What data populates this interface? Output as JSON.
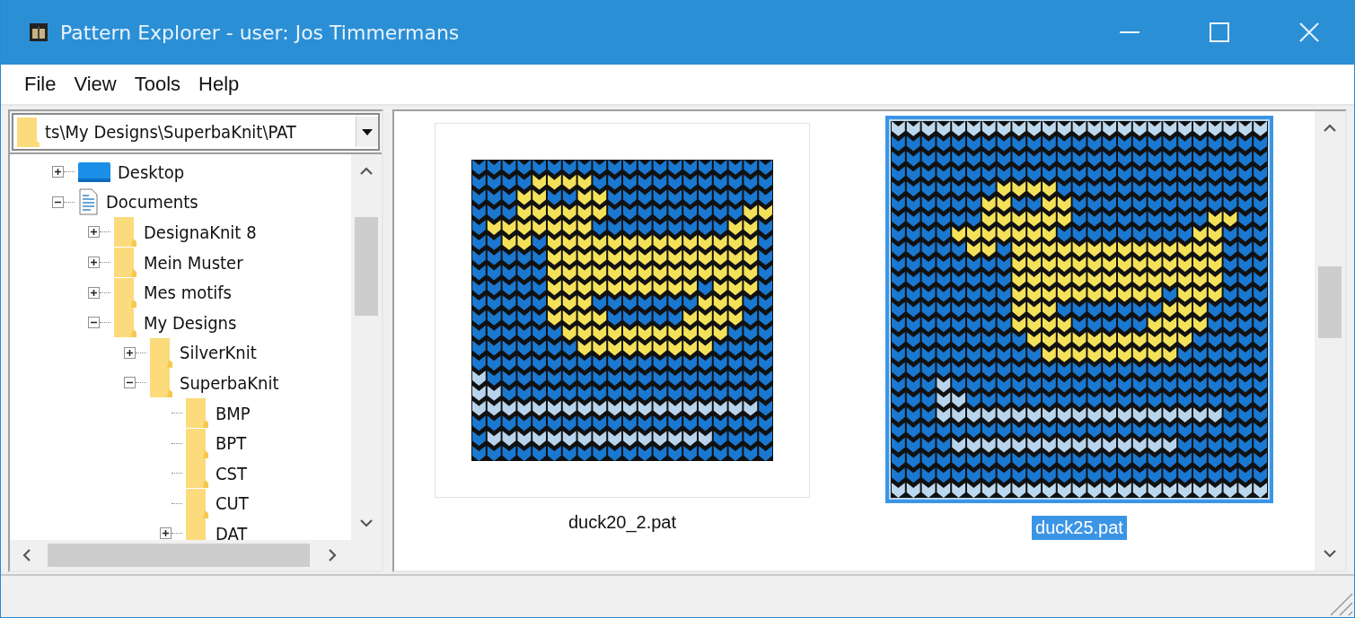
{
  "window": {
    "title": "Pattern Explorer - user: Jos Timmermans"
  },
  "menu": [
    "File",
    "View",
    "Tools",
    "Help"
  ],
  "path_box": {
    "value": "ts\\My Designs\\SuperbaKnit\\PAT"
  },
  "tree": [
    {
      "label": "Desktop",
      "kind": "desktop",
      "expanded": false
    },
    {
      "label": "Documents",
      "kind": "documents",
      "expanded": true,
      "children": [
        {
          "label": "DesignaKnit 8",
          "kind": "folder",
          "expanded": false
        },
        {
          "label": "Mein Muster",
          "kind": "folder",
          "expanded": false
        },
        {
          "label": "Mes motifs",
          "kind": "folder",
          "expanded": false
        },
        {
          "label": "My Designs",
          "kind": "folder",
          "expanded": true,
          "children": [
            {
              "label": "SilverKnit",
              "kind": "folder",
              "expanded": false
            },
            {
              "label": "SuperbaKnit",
              "kind": "folder",
              "expanded": true,
              "children": [
                {
                  "label": "BMP",
                  "kind": "folder"
                },
                {
                  "label": "BPT",
                  "kind": "folder"
                },
                {
                  "label": "CST",
                  "kind": "folder"
                },
                {
                  "label": "CUT",
                  "kind": "folder"
                },
                {
                  "label": "DAT",
                  "kind": "folder",
                  "expanded": false
                }
              ]
            }
          ]
        }
      ]
    }
  ],
  "files": [
    {
      "name": "duck20_2.pat",
      "kind": "small",
      "selected": false
    },
    {
      "name": "duck25.pat",
      "kind": "large",
      "selected": true
    }
  ]
}
